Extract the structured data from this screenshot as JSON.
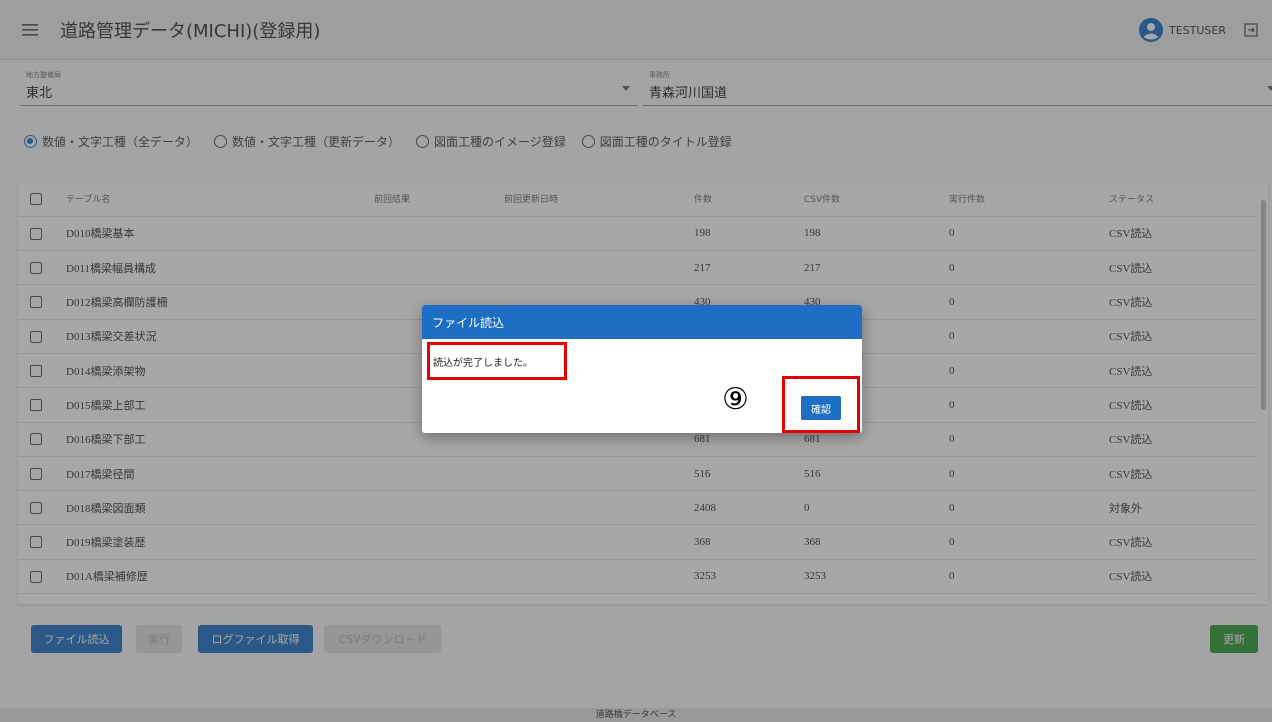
{
  "app": {
    "title": "道路管理データ(MICHI)(登録用)",
    "username": "TESTUSER",
    "icons": {
      "menu": "hamburger-menu-icon",
      "user": "account-circle-icon",
      "logout": "logout-icon"
    }
  },
  "filters": {
    "bureau": {
      "label": "地方整備局",
      "value": "東北"
    },
    "office": {
      "label": "事務所",
      "value": "青森河川国道"
    }
  },
  "modes": [
    {
      "label": "数値・文字工種（全データ）",
      "selected": true
    },
    {
      "label": "数値・文字工種（更新データ）",
      "selected": false
    },
    {
      "label": "図面工種のイメージ登録",
      "selected": false
    },
    {
      "label": "図面工種のタイトル登録",
      "selected": false
    }
  ],
  "table": {
    "columns": [
      "テーブル名",
      "前回結果",
      "前回更新日時",
      "件数",
      "CSV件数",
      "実行件数",
      "ステータス"
    ],
    "rows": [
      {
        "name": "D010橋梁基本",
        "result": "",
        "updated": "",
        "count": "198",
        "csv": "198",
        "exec": "0",
        "status": "CSV読込"
      },
      {
        "name": "D011橋梁幅員構成",
        "result": "",
        "updated": "",
        "count": "217",
        "csv": "217",
        "exec": "0",
        "status": "CSV読込"
      },
      {
        "name": "D012橋梁高欄防護柵",
        "result": "",
        "updated": "",
        "count": "430",
        "csv": "430",
        "exec": "0",
        "status": "CSV読込"
      },
      {
        "name": "D013橋梁交差状況",
        "result": "",
        "updated": "",
        "count": "",
        "csv": "",
        "exec": "0",
        "status": "CSV読込"
      },
      {
        "name": "D014橋梁添架物",
        "result": "",
        "updated": "",
        "count": "",
        "csv": "",
        "exec": "0",
        "status": "CSV読込"
      },
      {
        "name": "D015橋梁上部工",
        "result": "",
        "updated": "",
        "count": "",
        "csv": "",
        "exec": "0",
        "status": "CSV読込"
      },
      {
        "name": "D016橋梁下部工",
        "result": "",
        "updated": "",
        "count": "681",
        "csv": "681",
        "exec": "0",
        "status": "CSV読込"
      },
      {
        "name": "D017橋梁径間",
        "result": "",
        "updated": "",
        "count": "516",
        "csv": "516",
        "exec": "0",
        "status": "CSV読込"
      },
      {
        "name": "D018橋梁図面類",
        "result": "",
        "updated": "",
        "count": "2408",
        "csv": "0",
        "exec": "0",
        "status": "対象外"
      },
      {
        "name": "D019橋梁塗装歴",
        "result": "",
        "updated": "",
        "count": "368",
        "csv": "368",
        "exec": "0",
        "status": "CSV読込"
      },
      {
        "name": "D01A橋梁補修歴",
        "result": "",
        "updated": "",
        "count": "3253",
        "csv": "3253",
        "exec": "0",
        "status": "CSV読込"
      }
    ]
  },
  "buttons": {
    "load": "ファイル読込",
    "run": "実行",
    "log": "ログファイル取得",
    "csv_download": "CSVダウンロード",
    "refresh": "更新"
  },
  "footer": "道路橋データベース",
  "dialog": {
    "title": "ファイル読込",
    "message": "読込が完了しました。",
    "confirm": "確認",
    "step_marker": "⑨"
  },
  "colors": {
    "primary": "#1e6fc4",
    "green": "#2e9d39",
    "highlight": "#e60000"
  }
}
